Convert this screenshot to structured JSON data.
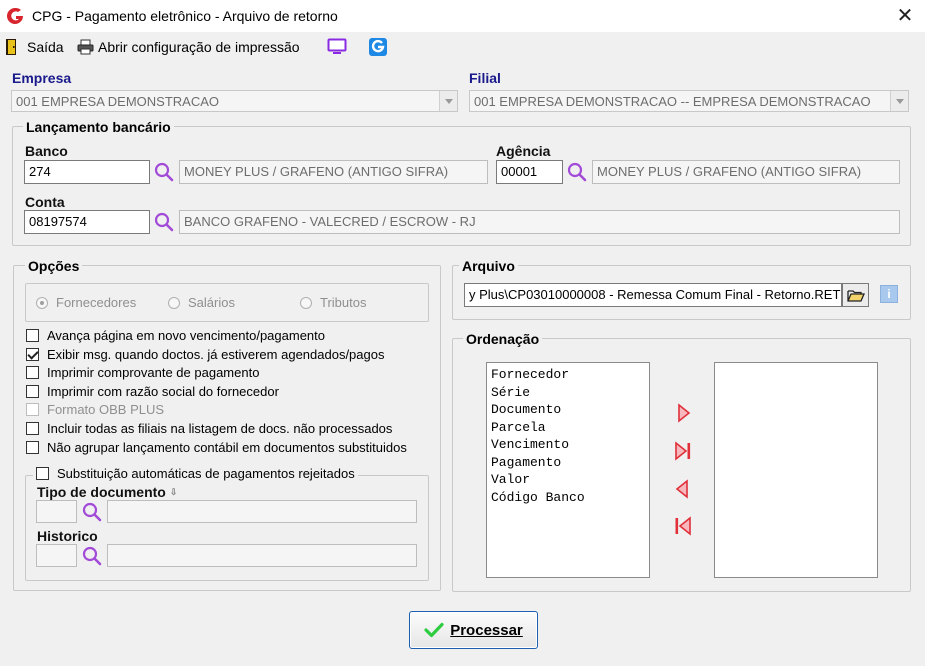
{
  "window": {
    "title": "CPG - Pagamento eletrônico - Arquivo de retorno"
  },
  "toolbar": {
    "exit_label": "Saída",
    "print_config_label": "Abrir configuração de impressão"
  },
  "empresa": {
    "label": "Empresa",
    "value": "001 EMPRESA DEMONSTRACAO"
  },
  "filial": {
    "label": "Filial",
    "value": "001 EMPRESA DEMONSTRACAO -- EMPRESA DEMONSTRACAO"
  },
  "lancamento": {
    "title": "Lançamento bancário",
    "banco_label": "Banco",
    "banco_code": "274",
    "banco_desc": "MONEY PLUS / GRAFENO (ANTIGO SIFRA)",
    "agencia_label": "Agência",
    "agencia_code": "00001",
    "agencia_desc": "MONEY PLUS / GRAFENO (ANTIGO SIFRA)",
    "conta_label": "Conta",
    "conta_code": "08197574",
    "conta_desc": "BANCO GRAFENO - VALECRED / ESCROW - RJ"
  },
  "opcoes": {
    "title": "Opções",
    "radios": [
      "Fornecedores",
      "Salários",
      "Tributos"
    ],
    "checks": [
      {
        "label": "Avança página em novo vencimento/pagamento",
        "checked": false,
        "enabled": true
      },
      {
        "label": "Exibir msg. quando doctos. já estiverem agendados/pagos",
        "checked": true,
        "enabled": true
      },
      {
        "label": "Imprimir comprovante de pagamento",
        "checked": false,
        "enabled": true
      },
      {
        "label": "Imprimir com razão social do fornecedor",
        "checked": false,
        "enabled": true
      },
      {
        "label": "Formato OBB PLUS",
        "checked": false,
        "enabled": false
      },
      {
        "label": "Incluir todas as filiais na listagem de docs. não processados",
        "checked": false,
        "enabled": true
      },
      {
        "label": "Não agrupar lançamento contábil em documentos substituidos",
        "checked": false,
        "enabled": true
      }
    ],
    "subst_title": "Substituição automáticas de pagamentos rejeitados",
    "tipo_doc_label": "Tipo de documento",
    "historico_label": "Historico"
  },
  "arquivo": {
    "title": "Arquivo",
    "path": "y Plus\\CP03010000008 - Remessa Comum Final - Retorno.RET"
  },
  "ordenacao": {
    "title": "Ordenação",
    "available": [
      "Fornecedor",
      "Série",
      "Documento",
      "Parcela",
      "Vencimento",
      "Pagamento",
      "Valor",
      "Código Banco"
    ],
    "selected": []
  },
  "actions": {
    "process_label": "Processar"
  }
}
